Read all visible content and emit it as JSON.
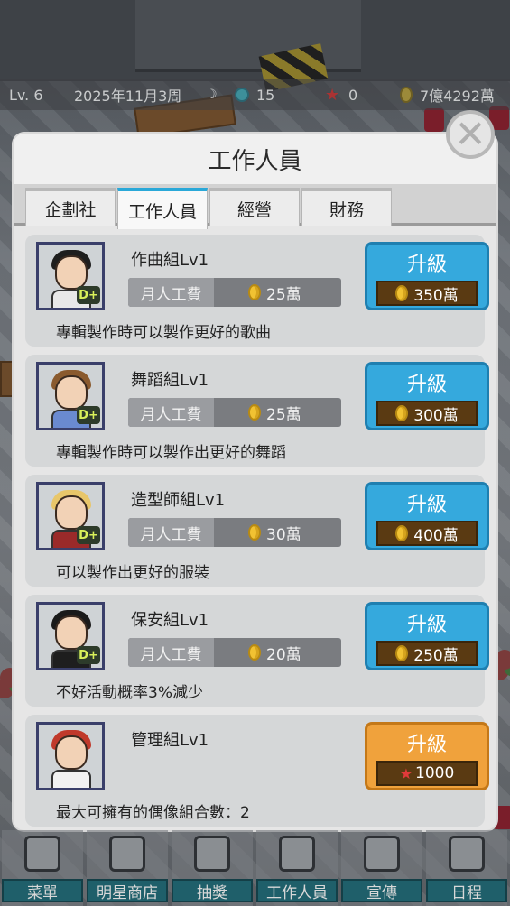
{
  "status_bar": {
    "level": "Lv. 6",
    "date": "2025年11月3周",
    "gems": "15",
    "stars": "0",
    "money": "7億4292萬"
  },
  "modal": {
    "title": "工作人員",
    "tabs": [
      {
        "label": "企劃社",
        "active": false
      },
      {
        "label": "工作人員",
        "active": true
      },
      {
        "label": "經營",
        "active": false
      },
      {
        "label": "財務",
        "active": false
      }
    ],
    "salary_label": "月人工費",
    "upgrade_label": "升級",
    "staff": [
      {
        "name": "作曲組Lv1",
        "salary": "25萬",
        "price": "350萬",
        "currency": "coin",
        "desc": "專輯製作時可以製作更好的歌曲",
        "badge": "D+",
        "button_color": "blue"
      },
      {
        "name": "舞蹈組Lv1",
        "salary": "25萬",
        "price": "300萬",
        "currency": "coin",
        "desc": "專輯製作時可以製作出更好的舞蹈",
        "badge": "D+",
        "button_color": "blue"
      },
      {
        "name": "造型師組Lv1",
        "salary": "30萬",
        "price": "400萬",
        "currency": "coin",
        "desc": "可以製作出更好的服裝",
        "badge": "D+",
        "button_color": "blue"
      },
      {
        "name": "保安組Lv1",
        "salary": "20萬",
        "price": "250萬",
        "currency": "coin",
        "desc": "不好活動概率3%減少",
        "badge": "D+",
        "button_color": "blue"
      },
      {
        "name": "管理組Lv1",
        "salary": null,
        "price": "1000",
        "currency": "star",
        "desc": "最大可擁有的偶像組合數：2",
        "badge": null,
        "button_color": "orange"
      }
    ]
  },
  "bottom_nav": [
    {
      "label": "菜單",
      "icon": "menu-icon"
    },
    {
      "label": "明星商店",
      "icon": "star-shop-icon"
    },
    {
      "label": "抽獎",
      "icon": "lottery-icon"
    },
    {
      "label": "工作人員",
      "icon": "staff-icon"
    },
    {
      "label": "宣傳",
      "icon": "megaphone-icon"
    },
    {
      "label": "日程",
      "icon": "calendar-icon"
    }
  ],
  "colors": {
    "tab_active_accent": "#2aa8d8",
    "upgrade_blue": "#35a9dd",
    "upgrade_orange": "#f0a23c",
    "price_bg": "#5a3a12"
  }
}
